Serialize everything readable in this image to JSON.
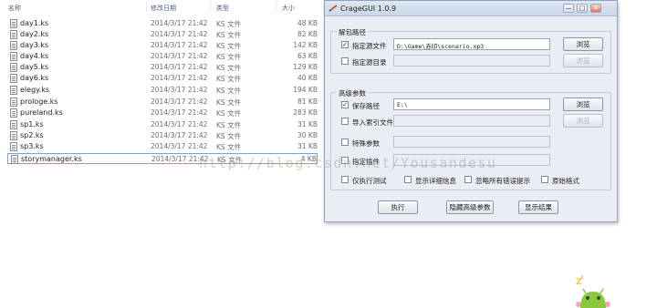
{
  "explorer": {
    "columns": {
      "name": "名称",
      "date": "修改日期",
      "type": "类型",
      "size": "大小"
    },
    "files": [
      {
        "name": "day1.ks",
        "date": "2014/3/17 21:42",
        "type": "KS 文件",
        "size": "48 KB"
      },
      {
        "name": "day2.ks",
        "date": "2014/3/17 21:42",
        "type": "KS 文件",
        "size": "82 KB"
      },
      {
        "name": "day3.ks",
        "date": "2014/3/17 21:42",
        "type": "KS 文件",
        "size": "142 KB"
      },
      {
        "name": "day4.ks",
        "date": "2014/3/17 21:42",
        "type": "KS 文件",
        "size": "63 KB"
      },
      {
        "name": "day5.ks",
        "date": "2014/3/17 21:42",
        "type": "KS 文件",
        "size": "129 KB"
      },
      {
        "name": "day6.ks",
        "date": "2014/3/17 21:42",
        "type": "KS 文件",
        "size": "40 KB"
      },
      {
        "name": "elegy.ks",
        "date": "2014/3/17 21:42",
        "type": "KS 文件",
        "size": "194 KB"
      },
      {
        "name": "prologe.ks",
        "date": "2014/3/17 21:42",
        "type": "KS 文件",
        "size": "81 KB"
      },
      {
        "name": "pureland.ks",
        "date": "2014/3/17 21:42",
        "type": "KS 文件",
        "size": "283 KB"
      },
      {
        "name": "sp1.ks",
        "date": "2014/3/17 21:42",
        "type": "KS 文件",
        "size": "31 KB"
      },
      {
        "name": "sp2.ks",
        "date": "2014/3/17 21:42",
        "type": "KS 文件",
        "size": "30 KB"
      },
      {
        "name": "sp3.ks",
        "date": "2014/3/17 21:42",
        "type": "KS 文件",
        "size": "31 KB"
      },
      {
        "name": "storymanager.ks",
        "date": "2014/3/17 21:42",
        "type": "KS 文件",
        "size": "4 KB"
      }
    ]
  },
  "window": {
    "title": "CrageGUI 1.0.9",
    "controls": {
      "minimize": "—",
      "maximize": "□",
      "close": "✕"
    },
    "unpack": {
      "label": "解包路径",
      "source_file": {
        "label": "指定源文件",
        "checked": true,
        "value": "D:\\Game\\赤印\\scenario.xp3",
        "button": "浏览"
      },
      "source_dir": {
        "label": "指定源目录",
        "checked": false,
        "value": "",
        "button": "浏览"
      }
    },
    "advanced": {
      "label": "高级参数",
      "save_path": {
        "label": "保存路径",
        "checked": true,
        "value": "E:\\",
        "button": "浏览"
      },
      "import_index": {
        "label": "导入索引文件",
        "checked": false,
        "value": "",
        "button": "浏览"
      },
      "special_params": {
        "label": "特殊参数",
        "checked": false,
        "value": ""
      },
      "plugin": {
        "label": "指定插件",
        "checked": false,
        "value": ""
      },
      "options": [
        {
          "label": "仅执行测试",
          "checked": false
        },
        {
          "label": "显示详细信息",
          "checked": false
        },
        {
          "label": "忽略所有错误提示",
          "checked": false
        },
        {
          "label": "原始格式",
          "checked": false
        }
      ]
    },
    "buttons": {
      "run": "执行",
      "hide_advanced": "隐藏高级参数",
      "show_result": "显示结果"
    }
  },
  "watermark": "http://blog.csdn.net/Yousandesu"
}
